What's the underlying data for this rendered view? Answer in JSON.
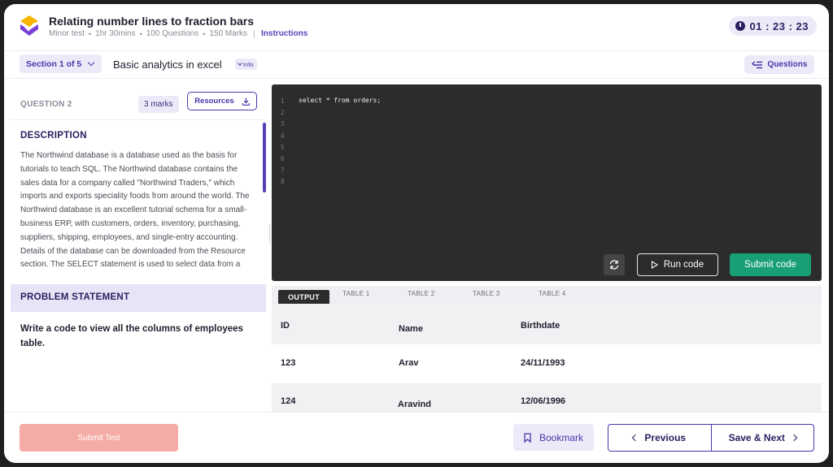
{
  "header": {
    "title": "Relating number lines to fraction bars",
    "meta": [
      "Minor test",
      "1hr 30mins",
      "100 Questions",
      "150 Marks"
    ],
    "instructions_label": "Instructions",
    "timer": "01 : 23 : 23"
  },
  "section_bar": {
    "section_label": "Section 1 of 5",
    "section_title": "Basic analytics in excel",
    "info_label": "Info",
    "questions_label": "Questions"
  },
  "question": {
    "label": "QUESTION 2",
    "marks": "3 marks",
    "resources_label": "Resources",
    "description_title": "DESCRIPTION",
    "description_text": "The Northwind database is a database used as the basis for tutorials to teach SQL. The Northwind database contains the sales data for a company called \"Northwind Traders,\" which imports and exports speciality foods from around the world. The Northwind database is an excellent tutorial schema for a small-business ERP, with customers, orders, inventory, purchasing, suppliers, shipping, employees, and single-entry accounting. Details of the database can be downloaded from the Resource section. The SELECT statement is used to select data from a",
    "problem_title": "PROBLEM STATEMENT",
    "problem_text": "Write a code to view all the columns of employees table."
  },
  "editor": {
    "line_numbers": [
      "1",
      "2",
      "3",
      "4",
      "5",
      "6",
      "7",
      "8"
    ],
    "code": "select * from orders;",
    "run_label": "Run code",
    "submit_label": "Submit code"
  },
  "output": {
    "tabs": [
      "OUTPUT",
      "TABLE 1",
      "TABLE 2",
      "TABLE 3",
      "TABLE 4"
    ],
    "columns": [
      "ID",
      "Name",
      "Birthdate"
    ],
    "rows": [
      [
        "123",
        "Arav",
        "24/11/1993"
      ],
      [
        "124",
        "Aravind",
        "12/06/1996"
      ]
    ]
  },
  "footer": {
    "submit_test_label": "Submit Test",
    "bookmark_label": "Bookmark",
    "previous_label": "Previous",
    "next_label": "Save & Next"
  },
  "colors": {
    "accent": "#4b35a8",
    "submit_code": "#189f76",
    "submit_test": "#f5aca6",
    "editor_bg": "#2c2c2c"
  }
}
